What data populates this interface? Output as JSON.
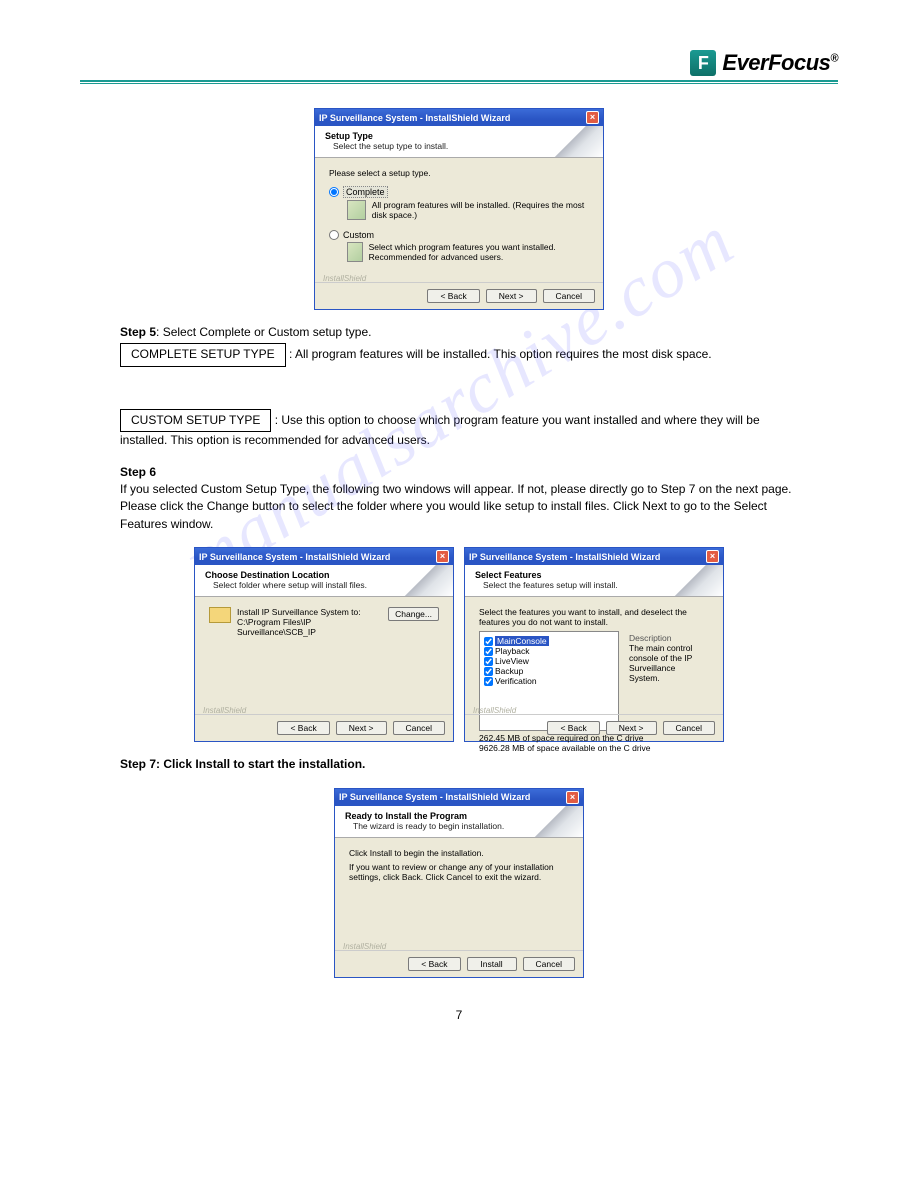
{
  "brand": {
    "name": "EverFocus",
    "mark": "F",
    "reg": "®"
  },
  "watermark": "manualsarchive.com",
  "dialog_setup": {
    "title": "IP Surveillance System - InstallShield Wizard",
    "header_title": "Setup Type",
    "header_desc": "Select the setup type to install.",
    "prompt": "Please select a setup type.",
    "options": [
      {
        "label": "Complete",
        "checked": true,
        "desc": "All program features will be installed. (Requires the most disk space.)"
      },
      {
        "label": "Custom",
        "checked": false,
        "desc": "Select which program features you want installed. Recommended for advanced users."
      }
    ],
    "install_shield": "InstallShield",
    "buttons": {
      "back": "< Back",
      "next": "Next >",
      "cancel": "Cancel"
    }
  },
  "step5": {
    "heading": "Step 5",
    "body": "Select Complete or Custom setup type.",
    "complete_label": "COMPLETE SETUP TYPE",
    "complete_body": " :  All program features will be installed. This option requires the most disk space.",
    "custom_label": "CUSTOM SETUP TYPE",
    "custom_body": "  :  Use this option to choose which program feature you want installed and where they will be installed. This option is recommended for advanced users."
  },
  "step6": {
    "heading": "Step 6",
    "body": "If you selected Custom Setup Type, the following two windows will appear. If not, please directly go to Step 7 on the next page. Please click the Change button to select the folder where you would like setup to install files. Click Next to go to the Select Features window."
  },
  "dialog_dest": {
    "title": "IP Surveillance System - InstallShield Wizard",
    "header_title": "Choose Destination Location",
    "header_desc": "Select folder where setup will install files.",
    "install_to": "Install IP Surveillance System to:",
    "path": "C:\\Program Files\\IP Surveillance\\SCB_IP",
    "change": "Change...",
    "install_shield": "InstallShield",
    "buttons": {
      "back": "< Back",
      "next": "Next >",
      "cancel": "Cancel"
    }
  },
  "dialog_features": {
    "title": "IP Surveillance System - InstallShield Wizard",
    "header_title": "Select Features",
    "header_desc": "Select the features setup will install.",
    "prompt": "Select the features you want to install, and deselect the features you do not want to install.",
    "features": [
      {
        "label": "MainConsole",
        "selected": true
      },
      {
        "label": "Playback",
        "selected": false
      },
      {
        "label": "LiveView",
        "selected": false
      },
      {
        "label": "Backup",
        "selected": false
      },
      {
        "label": "Verification",
        "selected": false
      }
    ],
    "desc_title": "Description",
    "desc_text": "The main control console of the IP Surveillance System.",
    "space_req": "262.45 MB of space required on the C drive",
    "space_avail": "9626.28 MB of space available on the C drive",
    "install_shield": "InstallShield",
    "buttons": {
      "back": "< Back",
      "next": "Next >",
      "cancel": "Cancel"
    }
  },
  "step7": {
    "heading": "Step 7: Click Install to start the installation."
  },
  "dialog_ready": {
    "title": "IP Surveillance System - InstallShield Wizard",
    "header_title": "Ready to Install the Program",
    "header_desc": "The wizard is ready to begin installation.",
    "line1": "Click Install to begin the installation.",
    "line2": "If you want to review or change any of your installation settings, click Back. Click Cancel to exit the wizard.",
    "install_shield": "InstallShield",
    "buttons": {
      "back": "< Back",
      "install": "Install",
      "cancel": "Cancel"
    }
  },
  "page_num": "7"
}
